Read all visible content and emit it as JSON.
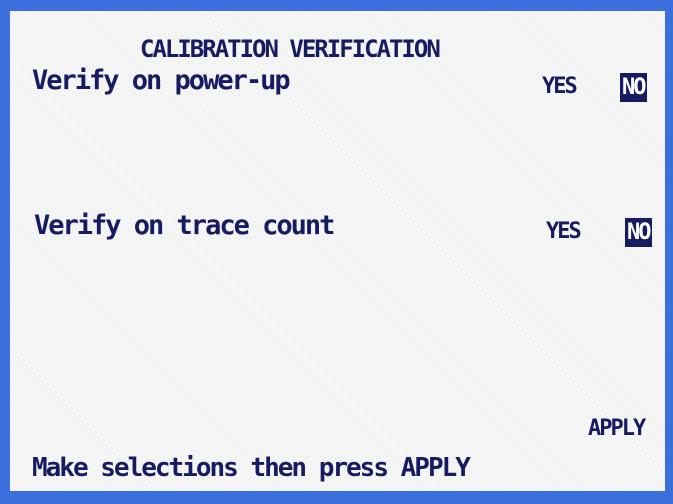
{
  "screen": {
    "title": "CALIBRATION VERIFICATION",
    "accent_color": "#3b6fdc",
    "text_color": "#171c62"
  },
  "settings": [
    {
      "label": "Verify on power-up",
      "options": [
        "YES",
        "NO"
      ],
      "selected": "NO"
    },
    {
      "label": "Verify on trace count",
      "options": [
        "YES",
        "NO"
      ],
      "selected": "NO"
    }
  ],
  "apply_label": "APPLY",
  "status_message": "Make selections then press APPLY"
}
